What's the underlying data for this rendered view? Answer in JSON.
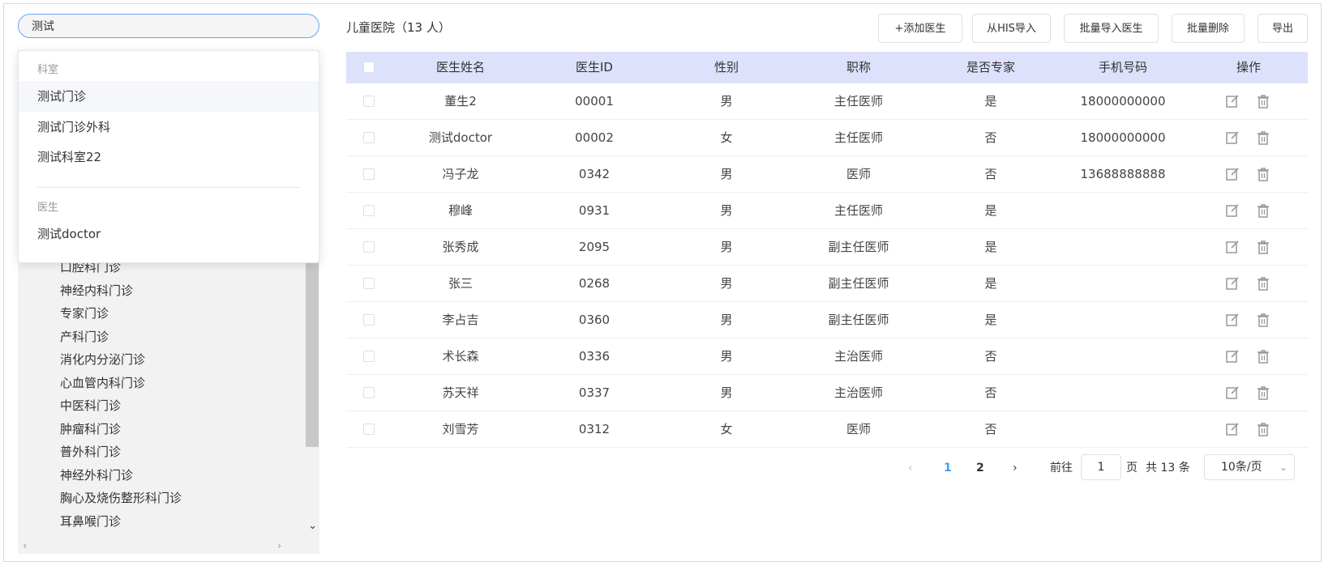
{
  "search": {
    "value": "测试"
  },
  "dropdown": {
    "group_department": "科室",
    "departments": [
      "测试门诊",
      "测试门诊外科",
      "测试科室22"
    ],
    "group_doctor": "医生",
    "doctors": [
      "测试doctor"
    ]
  },
  "tree": {
    "items": [
      "口腔科门诊",
      "神经内科门诊",
      "专家门诊",
      "产科门诊",
      "消化内分泌门诊",
      "心血管内科门诊",
      "中医科门诊",
      "肿瘤科门诊",
      "普外科门诊",
      "神经外科门诊",
      "胸心及烧伤整形科门诊",
      "耳鼻喉门诊"
    ]
  },
  "header": {
    "title": "儿童医院（13 人）",
    "buttons": [
      "+添加医生",
      "从HIS导入",
      "批量导入医生",
      "批量删除",
      "导出"
    ]
  },
  "table": {
    "columns": [
      "医生姓名",
      "医生ID",
      "性别",
      "职称",
      "是否专家",
      "手机号码",
      "操作"
    ],
    "rows": [
      [
        "董生2",
        "00001",
        "男",
        "主任医师",
        "是",
        "18000000000"
      ],
      [
        "测试doctor",
        "00002",
        "女",
        "主任医师",
        "否",
        "18000000000"
      ],
      [
        "冯子龙",
        "0342",
        "男",
        "医师",
        "否",
        "13688888888"
      ],
      [
        "穆峰",
        "0931",
        "男",
        "主任医师",
        "是",
        ""
      ],
      [
        "张秀成",
        "2095",
        "男",
        "副主任医师",
        "是",
        ""
      ],
      [
        "张三",
        "0268",
        "男",
        "副主任医师",
        "是",
        ""
      ],
      [
        "李占吉",
        "0360",
        "男",
        "副主任医师",
        "是",
        ""
      ],
      [
        "术长森",
        "0336",
        "男",
        "主治医师",
        "否",
        ""
      ],
      [
        "苏天祥",
        "0337",
        "男",
        "主治医师",
        "否",
        ""
      ],
      [
        "刘雪芳",
        "0312",
        "女",
        "医师",
        "否",
        ""
      ]
    ]
  },
  "pagination": {
    "pages": [
      "1",
      "2"
    ],
    "current": "1",
    "goto_prefix": "前往",
    "goto_value": "1",
    "goto_suffix": "页",
    "total": "共 13 条",
    "page_size": "10条/页"
  },
  "colors": {
    "accent": "#409eff",
    "header_bg": "#dde1fb",
    "search_border": "#6aa3e8"
  },
  "icons": {
    "edit": "edit-icon",
    "delete": "trash-icon"
  }
}
